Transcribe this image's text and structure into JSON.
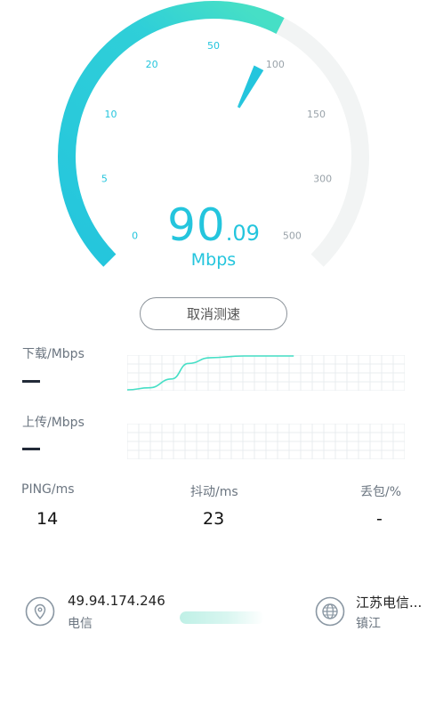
{
  "colors": {
    "accent": "#24c5dd",
    "accent_green": "#46dfc6",
    "track": "#f2f4f4",
    "tick_active": "#24c5dd",
    "tick_inactive": "#9aa3aa"
  },
  "gauge": {
    "value_int": "90",
    "value_dec": ".09",
    "unit": "Mbps",
    "ticks": [
      "0",
      "5",
      "10",
      "20",
      "50",
      "100",
      "150",
      "300",
      "500"
    ],
    "active_tick_count": 5
  },
  "cancel_button": {
    "label": "取消测速"
  },
  "download": {
    "label": "下载/Mbps",
    "value": "—",
    "curve": [
      [
        0,
        0
      ],
      [
        0.08,
        0.06
      ],
      [
        0.16,
        0.32
      ],
      [
        0.22,
        0.78
      ],
      [
        0.3,
        0.95
      ],
      [
        0.42,
        1
      ],
      [
        0.6,
        1
      ]
    ]
  },
  "upload": {
    "label": "上传/Mbps",
    "value": "—"
  },
  "stats": {
    "ping": {
      "label": "PING/ms",
      "value": "14"
    },
    "jitter": {
      "label": "抖动/ms",
      "value": "23"
    },
    "loss": {
      "label": "丢包/%",
      "value": "-"
    }
  },
  "client": {
    "ip": "49.94.174.246",
    "isp": "电信",
    "icon": "location-pin-icon"
  },
  "server": {
    "name": "江苏电信...",
    "city": "镇江",
    "icon": "globe-icon"
  },
  "progress": {
    "fraction": 0.75
  }
}
